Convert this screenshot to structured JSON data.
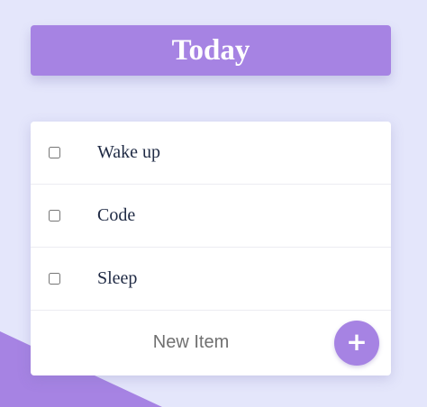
{
  "header": {
    "title": "Today"
  },
  "todo": {
    "items": [
      {
        "label": "Wake up",
        "checked": false
      },
      {
        "label": "Code",
        "checked": false
      },
      {
        "label": "Sleep",
        "checked": false
      }
    ],
    "new_item": {
      "placeholder": "New Item",
      "value": ""
    },
    "add_button": {
      "label": "+",
      "icon": "plus-icon"
    }
  },
  "colors": {
    "background": "#e4e6fb",
    "accent": "#a683e3",
    "card": "#ffffff"
  }
}
